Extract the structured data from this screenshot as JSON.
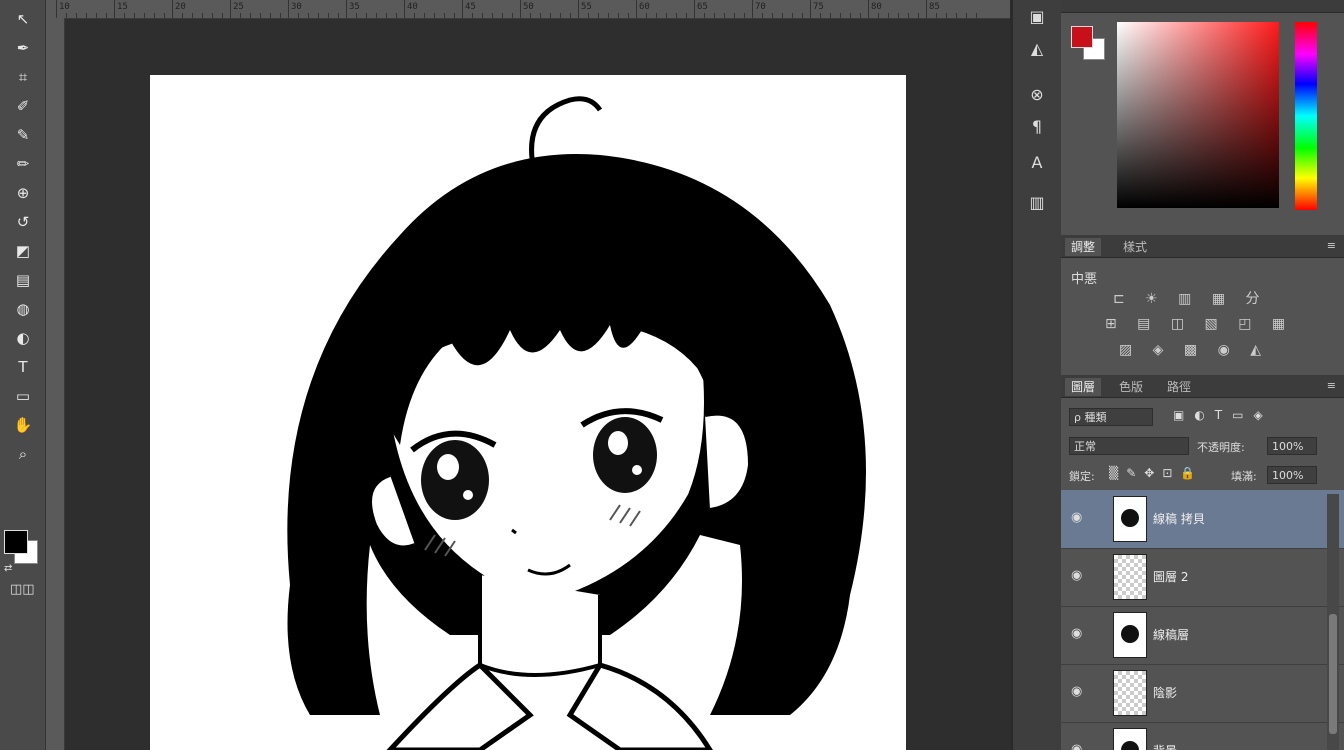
{
  "toolbar": {
    "tools": [
      {
        "name": "path-selection-tool-icon",
        "glyph": "↖"
      },
      {
        "name": "pen-tool-icon",
        "glyph": "✒"
      },
      {
        "name": "crop-tool-icon",
        "glyph": "⌗"
      },
      {
        "name": "eyedropper-tool-icon",
        "glyph": "✐"
      },
      {
        "name": "healing-brush-icon",
        "glyph": "✎"
      },
      {
        "name": "brush-tool-icon",
        "glyph": "✏"
      },
      {
        "name": "clone-stamp-icon",
        "glyph": "⊕"
      },
      {
        "name": "history-brush-icon",
        "glyph": "↺"
      },
      {
        "name": "eraser-tool-icon",
        "glyph": "◩"
      },
      {
        "name": "gradient-tool-icon",
        "glyph": "▤"
      },
      {
        "name": "blur-tool-icon",
        "glyph": "◍"
      },
      {
        "name": "dodge-tool-icon",
        "glyph": "◐"
      },
      {
        "name": "type-tool-icon",
        "glyph": "T"
      },
      {
        "name": "shape-tool-icon",
        "glyph": "▭"
      },
      {
        "name": "hand-tool-icon",
        "glyph": "✋"
      },
      {
        "name": "zoom-tool-icon",
        "glyph": "⌕"
      }
    ]
  },
  "ruler": {
    "labels": [
      "10",
      "15",
      "20",
      "25",
      "30",
      "35",
      "40",
      "45",
      "50",
      "55",
      "60",
      "65",
      "70",
      "75",
      "80",
      "85"
    ]
  },
  "icon_strip": {
    "buttons": [
      {
        "name": "history-panel-icon",
        "glyph": "▣"
      },
      {
        "name": "brush-panel-icon",
        "glyph": "◭"
      },
      {
        "name": "clone-source-icon",
        "glyph": "⊗"
      },
      {
        "name": "paragraph-panel-icon",
        "glyph": "¶"
      },
      {
        "name": "character-panel-icon",
        "glyph": "A"
      },
      {
        "name": "layer-comps-icon",
        "glyph": "▥"
      }
    ]
  },
  "color_panel": {
    "foreground": "#c8101a",
    "background": "#ffffff"
  },
  "adjustments_panel": {
    "tabs": [
      "調整",
      "樣式"
    ],
    "title": "中悪",
    "row1": "⊏ ☀ ▥ ▦ 分",
    "row2": "⊞ ▤ ◫ ▧ ◰ ▦",
    "row3": "▨ ◈ ▩ ◉ ◭"
  },
  "layers_panel": {
    "tabs": [
      "圖層",
      "色版",
      "路徑"
    ],
    "filter": "ρ 種類",
    "blend_mode": "正常",
    "opacity_label": "不透明度:",
    "opacity_value": "100%",
    "lock_label": "鎖定:",
    "fill_label": "填滿:",
    "fill_value": "100%",
    "layers": [
      {
        "name": "線稿 拷貝",
        "selected": true,
        "thumb": "art"
      },
      {
        "name": "圖層 2",
        "selected": false,
        "thumb": "transparent"
      },
      {
        "name": "線稿層",
        "selected": false,
        "thumb": "art"
      },
      {
        "name": "陰影",
        "selected": false,
        "thumb": "transparent"
      },
      {
        "name": "背景",
        "selected": false,
        "thumb": "art"
      }
    ]
  }
}
